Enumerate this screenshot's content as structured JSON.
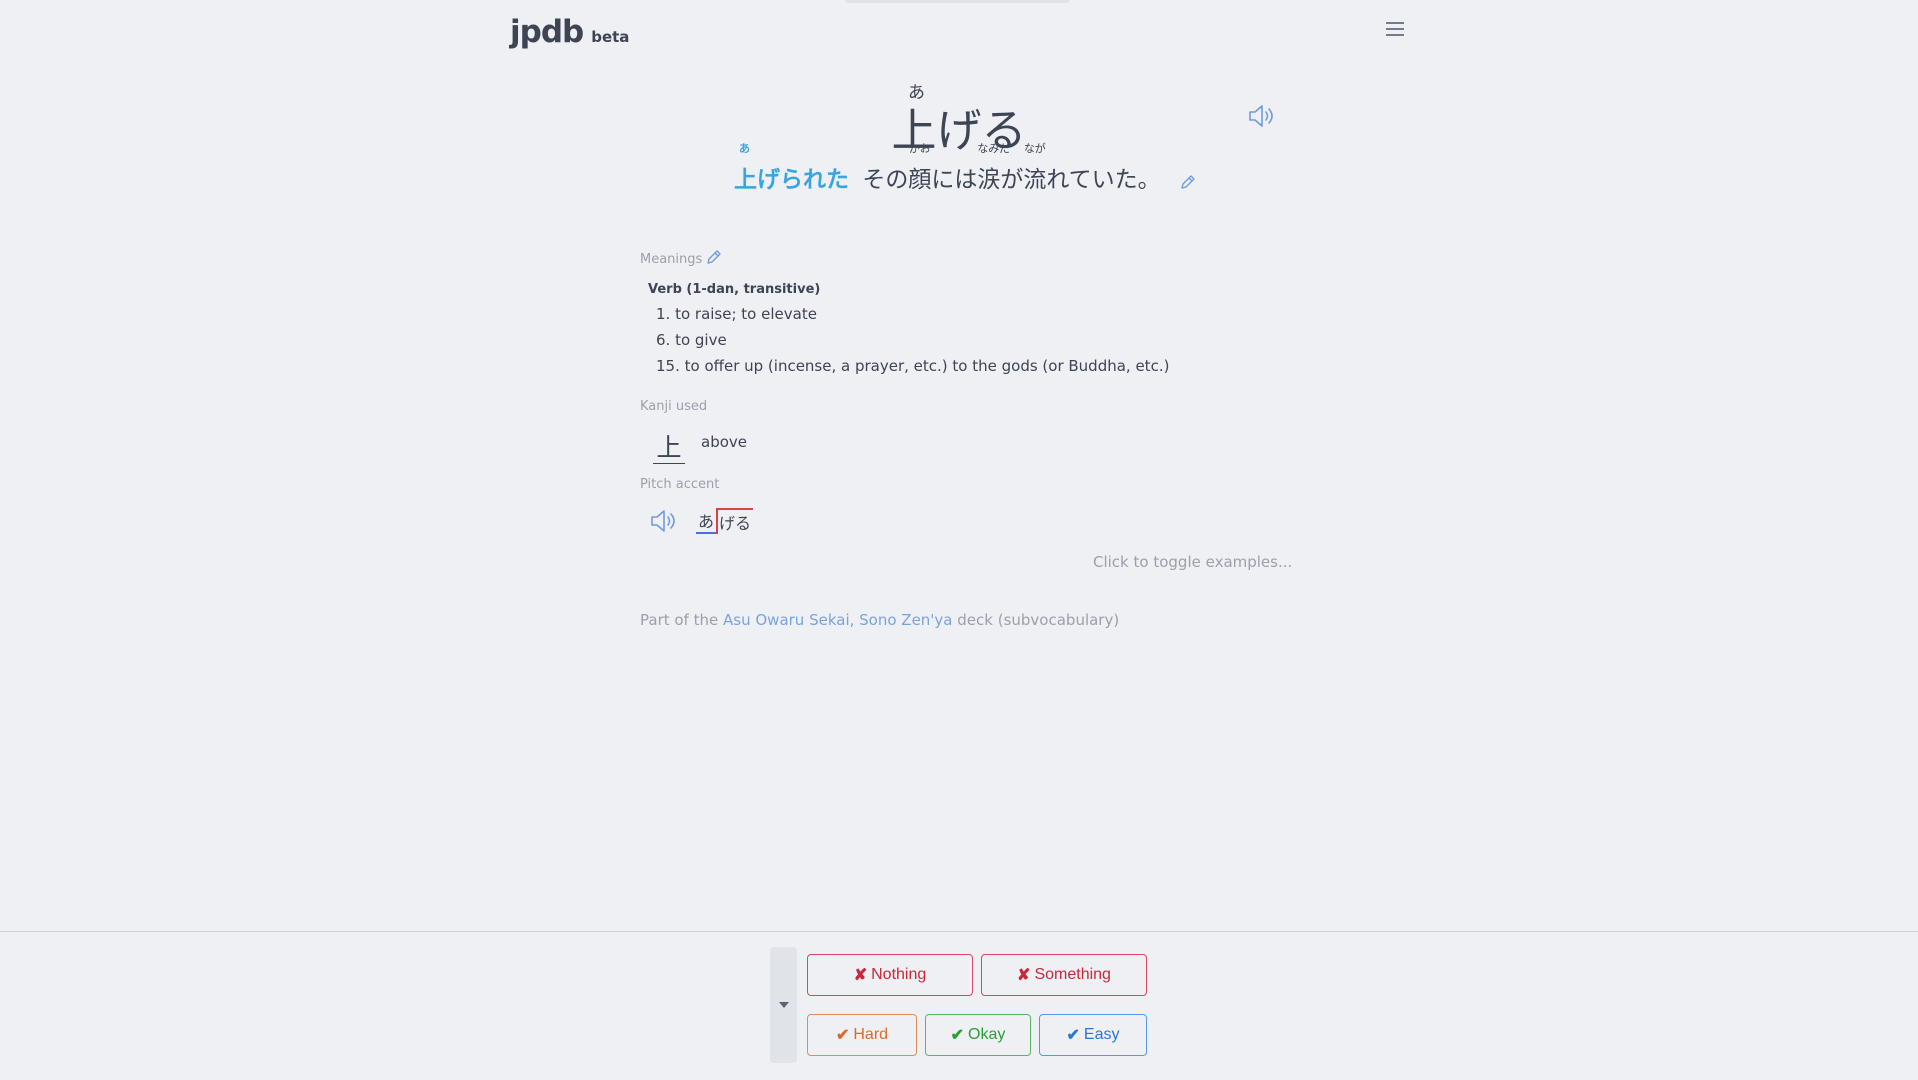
{
  "header": {
    "logo": "jpdb",
    "badge": "beta"
  },
  "word": {
    "reading": "あ",
    "spelling": "上げる"
  },
  "sentence": {
    "highlight": {
      "text": "上げられた",
      "furigana": "あ"
    },
    "segments": [
      {
        "text": "その",
        "furigana": ""
      },
      {
        "text": "顔",
        "furigana": "かお"
      },
      {
        "text": "には",
        "furigana": ""
      },
      {
        "text": "涙",
        "furigana": "なみだ"
      },
      {
        "text": "が",
        "furigana": ""
      },
      {
        "text": "流",
        "furigana": "なが"
      },
      {
        "text": "れていた。",
        "furigana": ""
      }
    ]
  },
  "meanings": {
    "label": "Meanings",
    "pos": "Verb (1-dan, transitive)",
    "items": [
      "1. to raise; to elevate",
      "6. to give",
      "15. to offer up (incense, a prayer, etc.) to the gods (or Buddha, etc.)"
    ]
  },
  "kanji": {
    "label": "Kanji used",
    "char": "上",
    "meaning": "above"
  },
  "pitch": {
    "label": "Pitch accent",
    "low": "あ",
    "high": "げる"
  },
  "examples_toggle": "Click to toggle examples...",
  "deck": {
    "prefix": "Part of the",
    "name": "Asu Owaru Sekai, Sono Zen'ya",
    "suffix": "deck (subvocabulary)"
  },
  "grading": {
    "nothing": "Nothing",
    "something": "Something",
    "hard": "Hard",
    "okay": "Okay",
    "easy": "Easy",
    "fail_mark": "✘",
    "pass_mark": "✔"
  },
  "colors": {
    "accent": "#3ba4e0",
    "fail": "#c8283c",
    "hard": "#dd6a2a",
    "okay": "#2e9d3a",
    "easy": "#2a78d6",
    "pitch_low": "#4b6de0",
    "pitch_high": "#e0404a"
  }
}
